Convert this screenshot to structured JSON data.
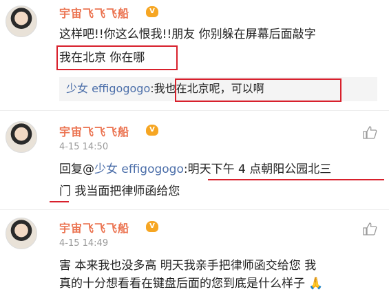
{
  "post1": {
    "author": "宇宙飞飞飞船",
    "badge": "V",
    "line1": "这样吧!!你这么恨我!!朋友 你别躲在屏幕后面敲字",
    "line2": "我在北京 你在哪",
    "reply": {
      "user": "少女 effigogogo",
      "sep": ":",
      "text": "我也在北京呢，可以啊"
    }
  },
  "post2": {
    "author": "宇宙飞飞飞船",
    "badge": "V",
    "time": "4-15 14:50",
    "reply_prefix": "回复@",
    "reply_user": "少女 effigogogo",
    "reply_sep": ":",
    "text_a": "明天下午 4 点朝阳公园北三",
    "text_b": "门",
    "text_c": " 我当面把律师函给您"
  },
  "post3": {
    "author": "宇宙飞飞飞船",
    "badge": "V",
    "time": "4-15 14:49",
    "line1": "害 本来我也没多高 明天我亲手把律师函交给您 我",
    "line2": "真的十分想看看在键盘后面的您到底是什么样子",
    "emoji": "🙏"
  },
  "colors": {
    "accent_name": "#eb7350",
    "link": "#4b6ea9",
    "highlight": "#d8202c"
  }
}
